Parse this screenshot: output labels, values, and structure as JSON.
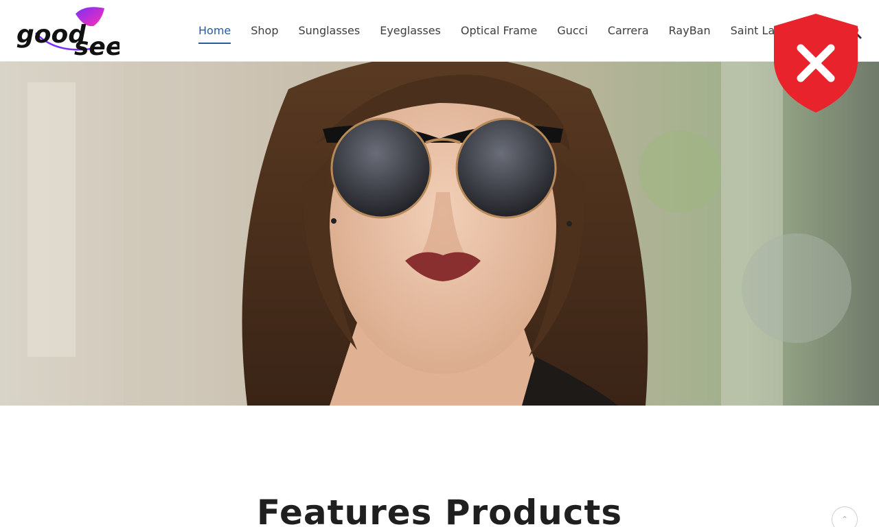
{
  "brand": {
    "logo_text_top": "good",
    "logo_text_bottom": "see"
  },
  "nav": {
    "items": [
      {
        "label": "Home",
        "active": true
      },
      {
        "label": "Shop",
        "active": false
      },
      {
        "label": "Sunglasses",
        "active": false
      },
      {
        "label": "Eyeglasses",
        "active": false
      },
      {
        "label": "Optical Frame",
        "active": false
      },
      {
        "label": "Gucci",
        "active": false
      },
      {
        "label": "Carrera",
        "active": false
      },
      {
        "label": "RayBan",
        "active": false
      },
      {
        "label": "Saint Lauren",
        "active": false
      }
    ],
    "search_icon": "search-icon"
  },
  "hero": {
    "image": "woman-wearing-round-sunglasses"
  },
  "overlay": {
    "icon": "shield-close-icon",
    "color": "#e8232c"
  },
  "section": {
    "title": "Features Products"
  },
  "colors": {
    "accent": "#2a5a9b",
    "logo_pink": "#d61f9b"
  }
}
